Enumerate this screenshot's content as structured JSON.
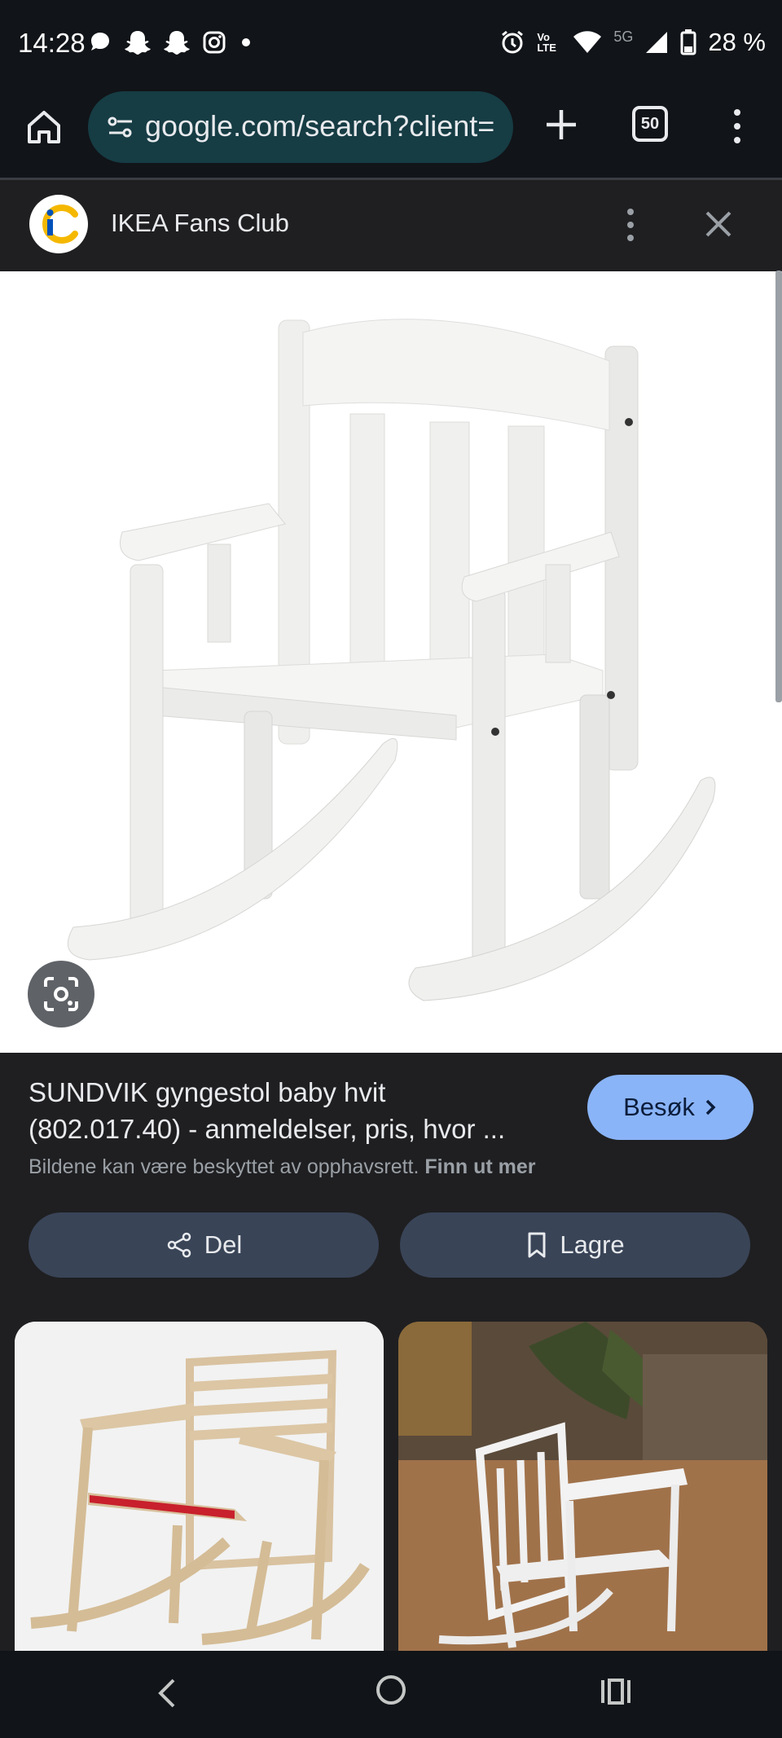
{
  "status_bar": {
    "time": "14:28",
    "battery_text": "28 %",
    "network_label": "5G",
    "volte_label": "Vo LTE",
    "left_icons": [
      "messages-icon",
      "snapchat-icon",
      "snapchat-icon",
      "instagram-icon",
      "dot-icon"
    ],
    "right_icons": [
      "alarm-icon",
      "volte-icon",
      "wifi-icon",
      "signal-icon",
      "battery-icon"
    ]
  },
  "browser": {
    "url": "google.com/search?client=",
    "tab_count": "50"
  },
  "source": {
    "name": "IKEA Fans Club",
    "logo_text": "iC"
  },
  "result": {
    "title_line1": "SUNDVIK gyngestol baby hvit",
    "title_line2": "(802.017.40) - anmeldelser, pris, hvor ...",
    "visit_label": "Besøk",
    "copyright_text": "Bildene kan være beskyttet av opphavsrett.",
    "learn_more": "Finn ut mer",
    "share_label": "Del",
    "save_label": "Lagre"
  },
  "colors": {
    "accent": "#8ab4f8",
    "omnibox": "#163c44",
    "action_button": "#394457",
    "background": "#1f1f21"
  }
}
